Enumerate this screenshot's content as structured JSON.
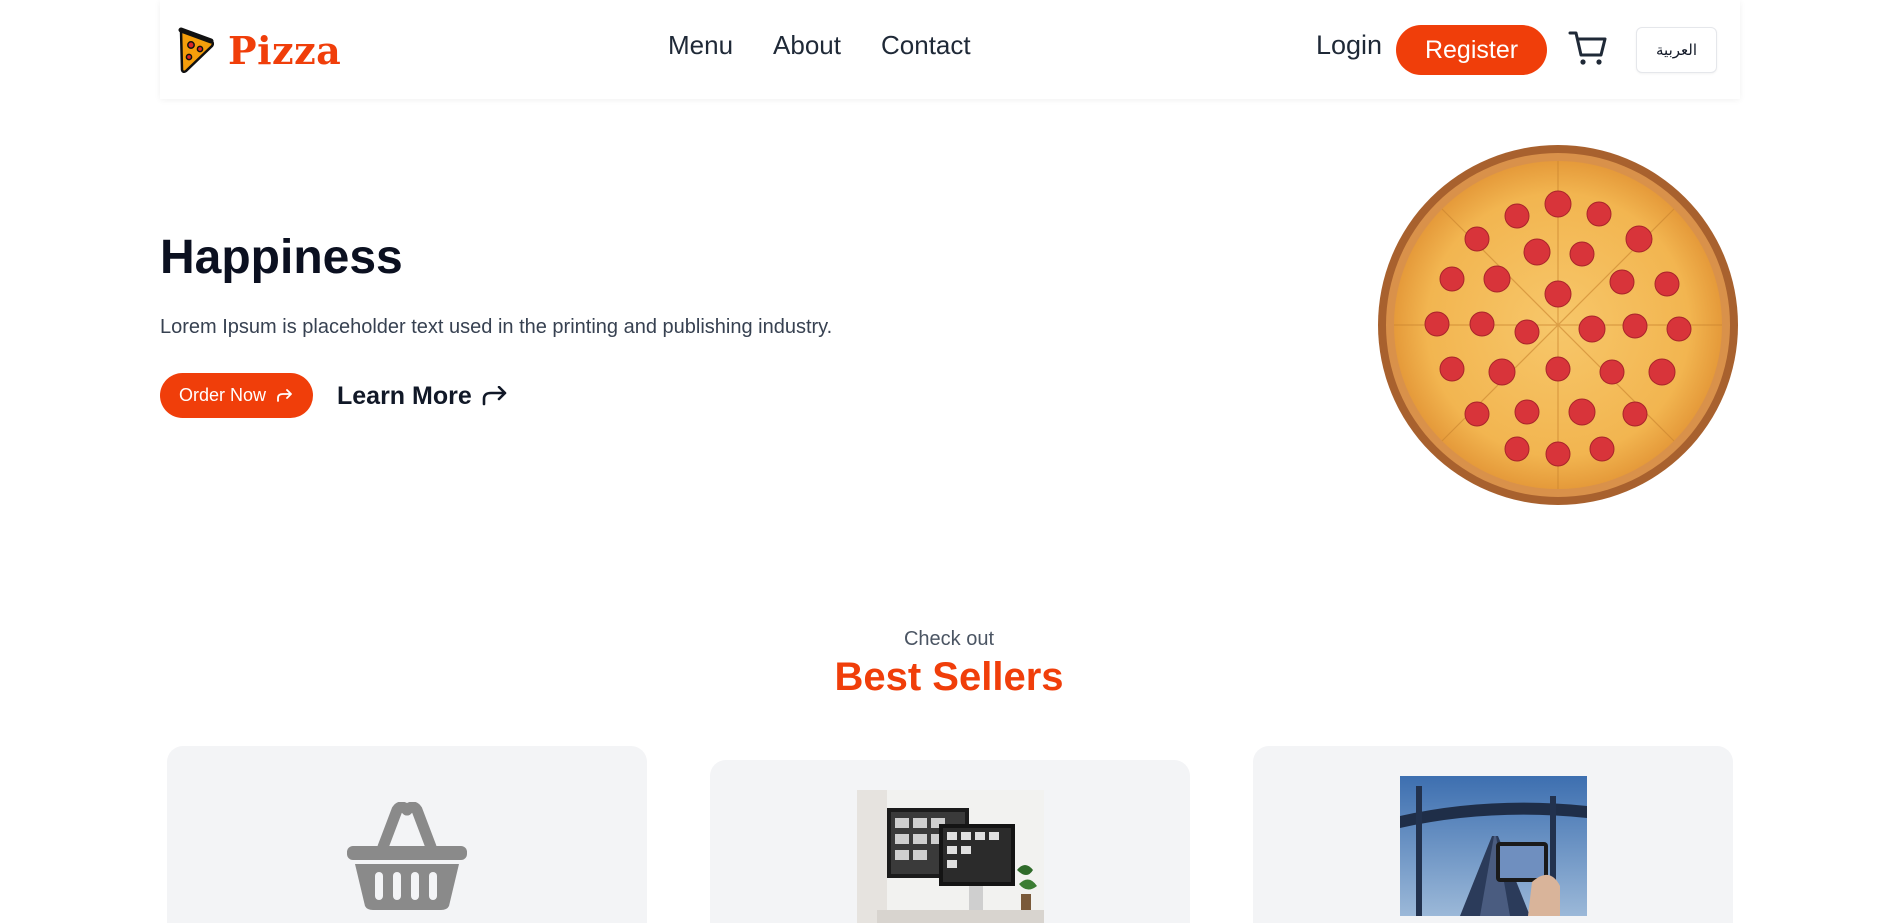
{
  "header": {
    "brand": "Pizza",
    "brand_icon": "pizza-slice-icon",
    "nav": [
      {
        "label": "Menu"
      },
      {
        "label": "About"
      },
      {
        "label": "Contact"
      }
    ],
    "login_label": "Login",
    "register_label": "Register",
    "cart_icon": "cart-icon",
    "language_label": "العربية"
  },
  "hero": {
    "title": "Happiness",
    "description": "Lorem Ipsum is placeholder text used in the printing and publishing industry.",
    "order_label": "Order Now",
    "learn_label": "Learn More",
    "image": "pepperoni-pizza"
  },
  "best_sellers": {
    "kicker": "Check out",
    "title": "Best Sellers",
    "cards": [
      {
        "image": "basket-icon"
      },
      {
        "image": "computer-monitors-photo"
      },
      {
        "image": "phone-bridge-photo"
      }
    ]
  },
  "colors": {
    "accent": "#f03e0a",
    "text": "#111827",
    "muted": "#4b5563",
    "card_bg": "#f3f4f6"
  }
}
